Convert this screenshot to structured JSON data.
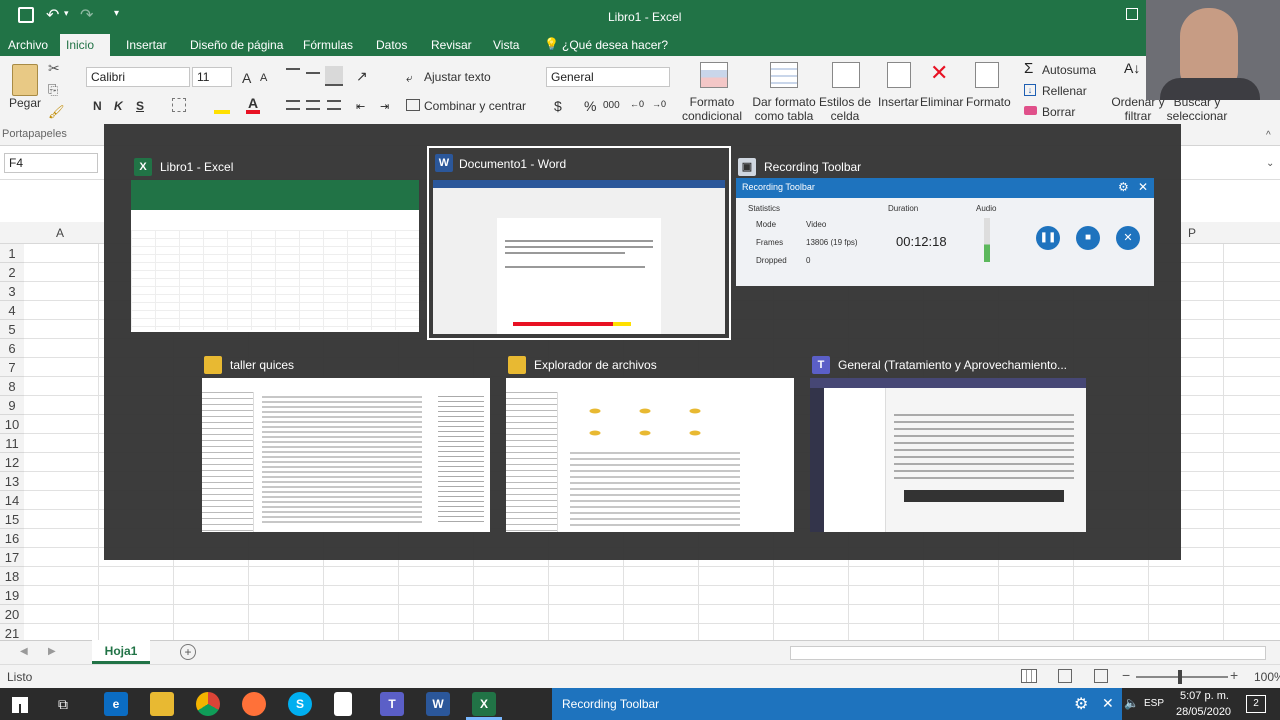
{
  "window": {
    "title": "Libro1 - Excel"
  },
  "ribbon_tabs": [
    "Archivo",
    "Inicio",
    "Insertar",
    "Diseño de página",
    "Fórmulas",
    "Datos",
    "Revisar",
    "Vista",
    "¿Qué desea hacer?"
  ],
  "ribbon": {
    "paste_label": "Pegar",
    "clipboard_group": "Portapapeles",
    "font_name": "Calibri",
    "font_size": "11",
    "bold": "N",
    "italic": "K",
    "underline": "S",
    "wrap_text": "Ajustar texto",
    "merge_center": "Combinar y centrar",
    "number_format": "General",
    "currency_symbol": "$",
    "percent_symbol": "%",
    "thousands_symbol": "000",
    "conditional_format": "Formato condicional",
    "format_as_table": "Dar formato como tabla",
    "cell_styles": "Estilos de celda",
    "insert": "Insertar",
    "delete": "Eliminar",
    "format": "Formato",
    "autosum": "Autosuma",
    "fill": "Rellenar",
    "clear": "Borrar",
    "sort_filter": "Ordenar y filtrar",
    "find_select": "Buscar y seleccionar"
  },
  "formula_bar": {
    "name_box": "F4"
  },
  "grid": {
    "columns": [
      "A",
      "P"
    ],
    "rows": [
      "1",
      "2",
      "3",
      "4",
      "5",
      "6",
      "7",
      "8",
      "9",
      "10",
      "11",
      "12",
      "13",
      "14",
      "15",
      "16",
      "17",
      "18",
      "19",
      "20",
      "21"
    ]
  },
  "sheet": {
    "tab": "Hoja1"
  },
  "status": {
    "ready": "Listo",
    "zoom": "100%"
  },
  "switcher": {
    "windows": [
      {
        "title": "Libro1 - Excel",
        "icon": "excel-icon"
      },
      {
        "title": "Documento1 - Word",
        "icon": "word-icon"
      },
      {
        "title": "Recording Toolbar",
        "icon": "recorder-icon"
      },
      {
        "title": "taller quices",
        "icon": "folder-icon"
      },
      {
        "title": "Explorador de archivos",
        "icon": "file-explorer-icon"
      },
      {
        "title": "General (Tratamiento y Aprovechamiento...",
        "icon": "teams-icon"
      }
    ]
  },
  "recording_toolbar": {
    "title": "Recording Toolbar",
    "statistics_label": "Statistics",
    "mode_label": "Mode",
    "mode_value": "Video",
    "frames_label": "Frames",
    "frames_value": "13806 (19 fps)",
    "dropped_label": "Dropped",
    "dropped_value": "0",
    "duration_label": "Duration",
    "duration_value": "00:12:18",
    "audio_label": "Audio"
  },
  "taskbar": {
    "active_app": "Recording Toolbar",
    "language": "ESP",
    "time": "5:07 p. m.",
    "date": "28/05/2020",
    "notifications": "2"
  },
  "colors": {
    "excel_green": "#217346",
    "word_blue": "#2b579a",
    "teams_purple": "#5b5fc7",
    "recorder_blue": "#1e73be"
  }
}
